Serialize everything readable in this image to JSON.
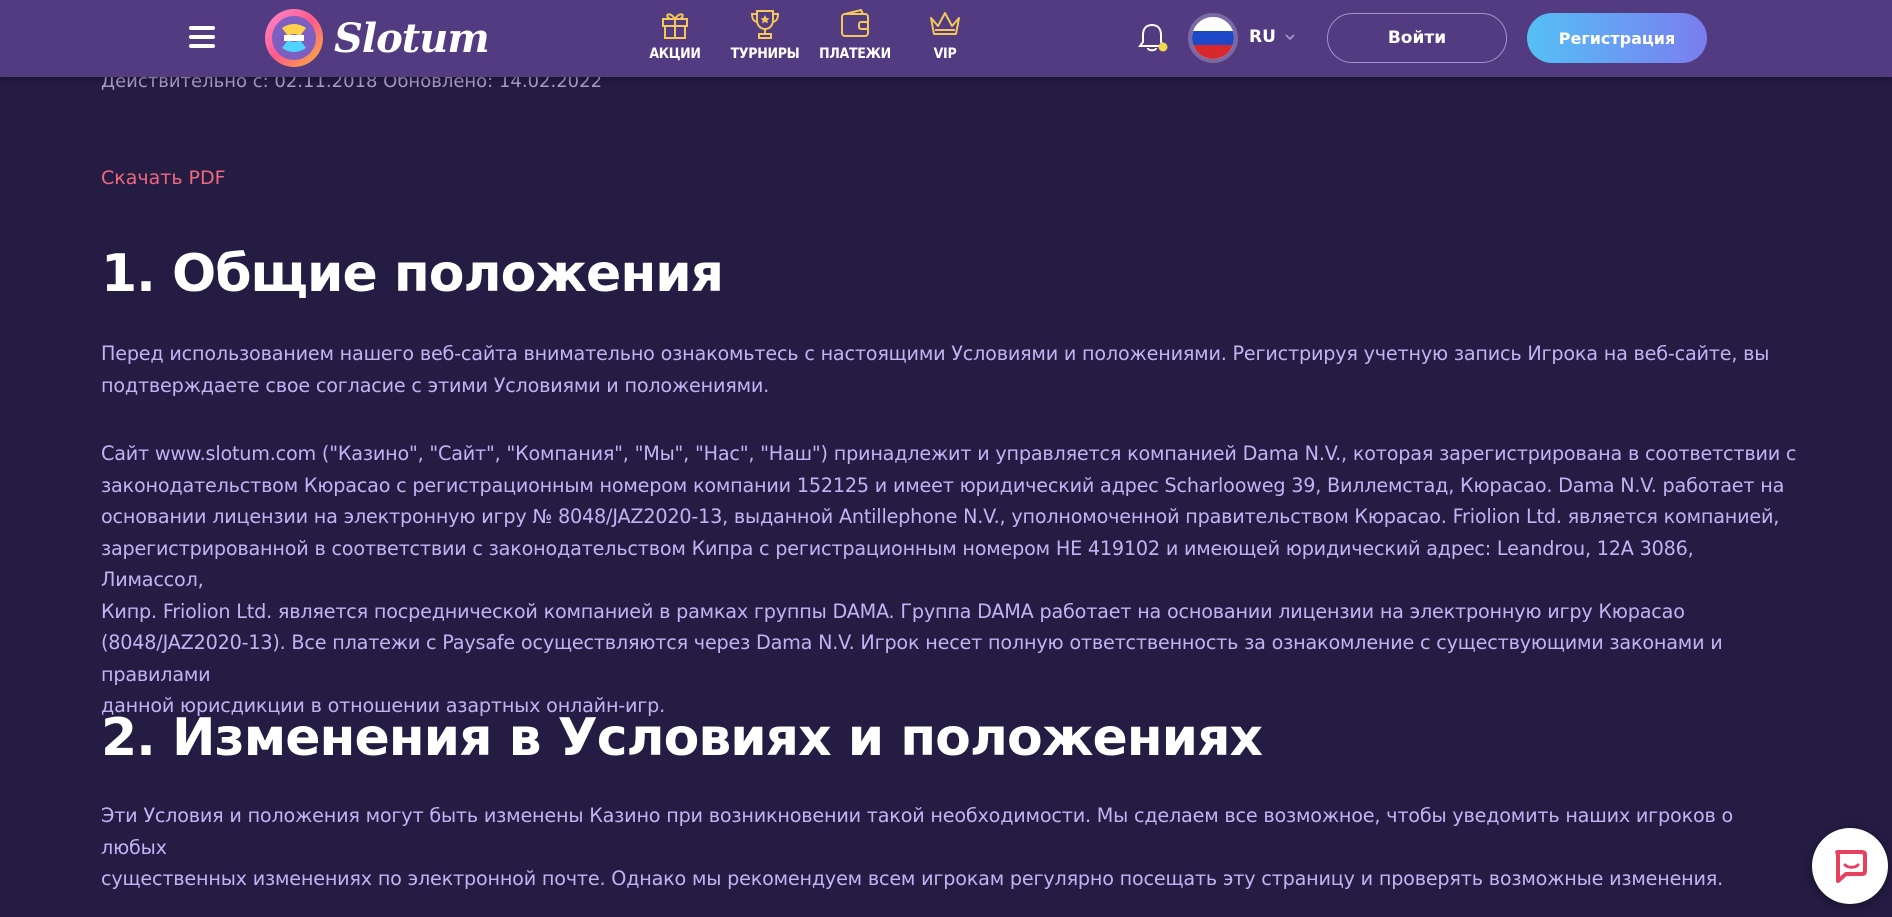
{
  "header": {
    "logo_text": "Slotum",
    "nav": [
      {
        "label": "АКЦИИ",
        "icon": "gift-icon"
      },
      {
        "label": "ТУРНИРЫ",
        "icon": "trophy-icon"
      },
      {
        "label": "ПЛАТЕЖИ",
        "icon": "wallet-icon"
      },
      {
        "label": "VIP",
        "icon": "crown-icon"
      }
    ],
    "language": "RU",
    "login_label": "Войти",
    "register_label": "Регистрация",
    "colors": {
      "accent_gold": "#f3c75a",
      "header_bg": "#523b81",
      "link_pink": "#f0697d"
    }
  },
  "main": {
    "validity": "Действительно с: 02.11.2018 Обновлено: 14.02.2022",
    "pdf_link": "Скачать PDF",
    "section1_title": "1. Общие положения",
    "section1_p1_lines": [
      "Перед использованием нашего веб-сайта внимательно ознакомьтесь с настоящими Условиями и положениями. Регистрируя учетную запись Игрока на веб-сайте, вы",
      "подтверждаете свое согласие с этими Условиями и положениями."
    ],
    "section1_p2_lines": [
      "Сайт www.slotum.com (\"Казино\", \"Сайт\", \"Компания\", \"Мы\", \"Нас\", \"Наш\") принадлежит и управляется компанией Dama N.V., которая зарегистрирована в соответствии с",
      "законодательством Кюрасао с регистрационным номером компании 152125 и имеет юридический адрес Scharlooweg 39, Виллемстад, Кюрасао. Dama N.V. работает на",
      "основании лицензии на электронную игру № 8048/JAZ2020-13, выданной Antillephone N.V., уполномоченной правительством Кюрасао. Friolion Ltd. является компанией,",
      "зарегистрированной в соответствии с законодательством Кипра с регистрационным номером HE 419102 и имеющей юридический адрес: Leandrou, 12A 3086, Лимассол,",
      "Кипр. Friolion Ltd. является посреднической компанией в рамках группы DAMA. Группа DAMA работает на основании лицензии на электронную игру Кюрасао",
      "(8048/JAZ2020-13). Все платежи с Paysafe осуществляются через Dama N.V. Игрок несет полную ответственность за ознакомление с существующими законами и правилами",
      "данной юрисдикции в отношении азартных онлайн-игр."
    ],
    "section2_title": "2. Изменения в Условиях и положениях",
    "section2_p1_lines": [
      "Эти Условия и положения могут быть изменены Казино при возникновении такой необходимости. Мы сделаем все возможное, чтобы уведомить наших игроков о любых",
      "существенных изменениях по электронной почте. Однако мы рекомендуем всем игрокам регулярно посещать эту страницу и проверять возможные изменения."
    ]
  }
}
